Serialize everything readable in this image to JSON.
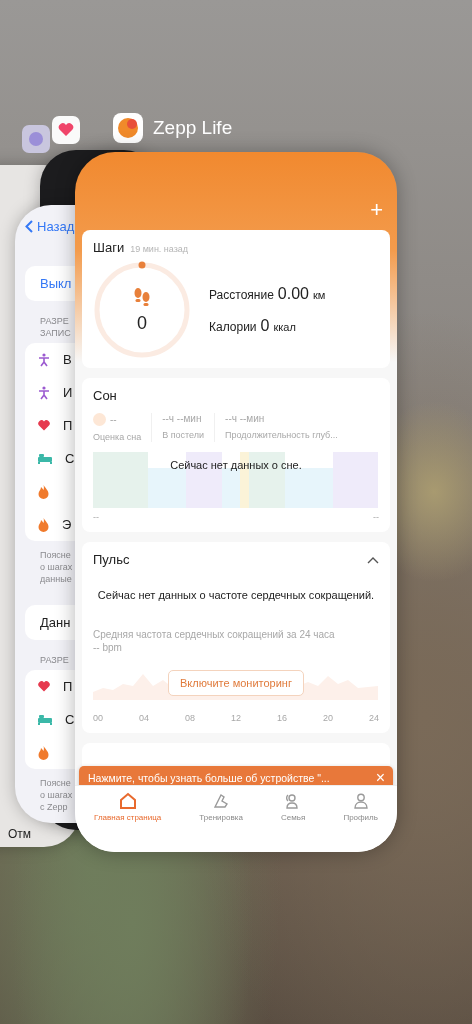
{
  "switcher": {
    "app_name": "Zepp Life"
  },
  "background_apps": {
    "far_label": "Отм",
    "health": {
      "back": "Назад",
      "toggle": "Выкл",
      "section_1": [
        "РАЗРЕ",
        "ЗАПИС"
      ],
      "items_1": [
        {
          "kind": "figure",
          "label": "В"
        },
        {
          "kind": "figure",
          "label": "И"
        },
        {
          "kind": "heart",
          "label": "П"
        },
        {
          "kind": "bed",
          "label": "С"
        },
        {
          "kind": "flame"
        },
        {
          "kind": "flame",
          "label": "Э"
        }
      ],
      "note_1": [
        "Поясне",
        "о шагах",
        "данные"
      ],
      "data_row": "Данн",
      "section_2": [
        "РАЗРЕ"
      ],
      "items_2": [
        {
          "kind": "heart",
          "label": "П"
        },
        {
          "kind": "bed",
          "label": "С"
        },
        {
          "kind": "flame"
        }
      ],
      "note_2": [
        "Поясне",
        "о шагах",
        "с Zepp"
      ]
    }
  },
  "app": {
    "add_button": "+",
    "steps": {
      "title": "Шаги",
      "updated": "19 мин. назад",
      "count": "0",
      "level": 0,
      "distance_label": "Расстояние",
      "distance_value": "0.00",
      "distance_unit": "км",
      "calories_label": "Калории",
      "calories_value": "0",
      "calories_unit": "ккал"
    },
    "sleep": {
      "title": "Сон",
      "stats": [
        {
          "value": "--",
          "label": "Оценка сна",
          "kind": "score"
        },
        {
          "value": "--ч --мин",
          "label": "В постели",
          "kind": "time"
        },
        {
          "value": "--ч --мин",
          "label": "Продолжительность глуб...",
          "kind": "time"
        }
      ],
      "empty_message": "Сейчас нет данных о сне.",
      "axis_start": "--",
      "axis_end": "--"
    },
    "pulse": {
      "title": "Пульс",
      "expanded": true,
      "empty_message": "Сейчас нет данных о частоте сердечных сокращений.",
      "average_label": "Средняя частота сердечных сокращений за 24 часа",
      "average_value": "-- bpm",
      "button": "Включите мониторинг",
      "hours": [
        "00",
        "04",
        "08",
        "12",
        "16",
        "20",
        "24"
      ]
    },
    "toast": {
      "text": "Нажмите, чтобы узнать больше об устройстве \"...",
      "close": "×"
    },
    "tabs": [
      {
        "label": "Главная страница",
        "kind": "home",
        "selected": true
      },
      {
        "label": "Тренировка",
        "kind": "shoe",
        "selected": false
      },
      {
        "label": "Семья",
        "kind": "family",
        "selected": false
      },
      {
        "label": "Профиль",
        "kind": "profile",
        "selected": false
      }
    ]
  }
}
